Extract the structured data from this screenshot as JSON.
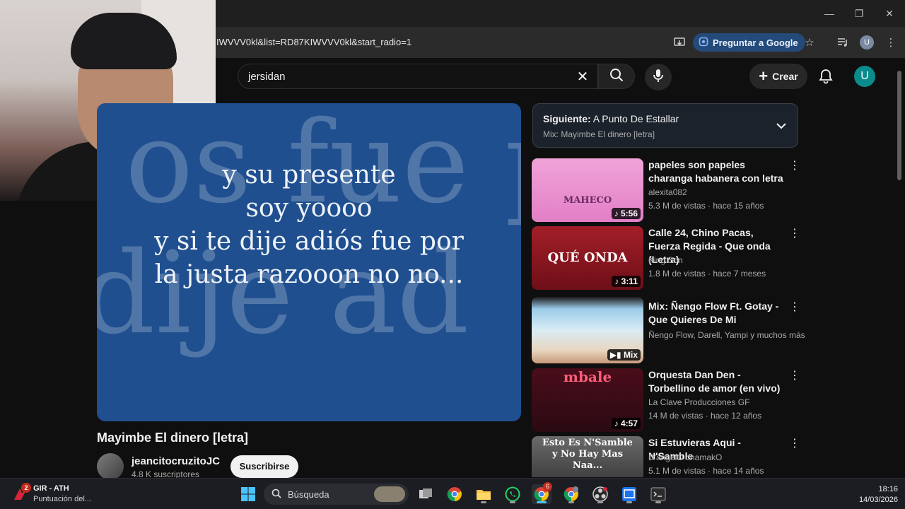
{
  "browser": {
    "url": "IWVVV0kl&list=RD87KIWVVV0kl&start_radio=1",
    "ask_google_label": "Preguntar a Google",
    "avatar_letter": "U"
  },
  "youtube": {
    "search_query": "jersidan",
    "create_label": "Crear",
    "avatar_letter": "U"
  },
  "player": {
    "lyrics": [
      "y su presente",
      "soy yoooo",
      "y si te dije adiós fue por",
      "la justa razooon no no..."
    ]
  },
  "video": {
    "title": "Mayimbe El dinero [letra]",
    "channel_name": "jeancitocruzitoJC",
    "subscribers": "4.8 K suscriptores",
    "subscribe_label": "Suscribirse"
  },
  "up_next": {
    "prefix": "Siguiente:",
    "title": "A Punto De Estallar",
    "mix_label": "Mix: Mayimbe El dinero [letra]"
  },
  "recommendations": [
    {
      "title": "papeles son papeles charanga habanera con letra",
      "channel": "alexita082",
      "meta": "5.3 M de vistas · hace 15 años",
      "duration": "5:56",
      "thumb_caption": "MAHECO"
    },
    {
      "title": "Calle 24, Chino Pacas, Fuerza Regida - Que onda (Letra)",
      "channel": "King Son",
      "meta": "1.8 M de vistas · hace 7 meses",
      "duration": "3:11",
      "thumb_caption": "QUÉ ONDA"
    },
    {
      "title": "Mix: Ñengo Flow Ft. Gotay - Que Quieres De Mi",
      "channel": "Ñengo Flow, Darell, Yampi y muchos más",
      "meta": "",
      "duration": "Mix",
      "thumb_caption": ""
    },
    {
      "title": "Orquesta Dan Den - Torbellino de amor (en vivo)",
      "channel": "La Clave Producciones GF",
      "meta": "14 M de vistas · hace 12 años",
      "duration": "4:57",
      "thumb_caption": "mbale"
    },
    {
      "title": "Si Estuvieras Aqui - N'Samble",
      "channel": "D'angelO chamakO",
      "meta": "5.1 M de vistas · hace 14 años",
      "duration": "",
      "thumb_caption": "Esto Es N'Samble y No Hay Mas Naa..."
    }
  ],
  "taskbar": {
    "weather_title": "GIR - ATH",
    "weather_subtitle": "Puntuación del...",
    "weather_badge": "2",
    "search_label": "Búsqueda",
    "chrome_badge": "6",
    "time": "18:16",
    "date": "14/03/2026"
  },
  "colors": {
    "player_bg": "#1f4f8f",
    "subscribe_bg": "#f1f1f1",
    "ask_google_bg": "#244a7a",
    "avatar_bg": "#0a8c8c"
  }
}
